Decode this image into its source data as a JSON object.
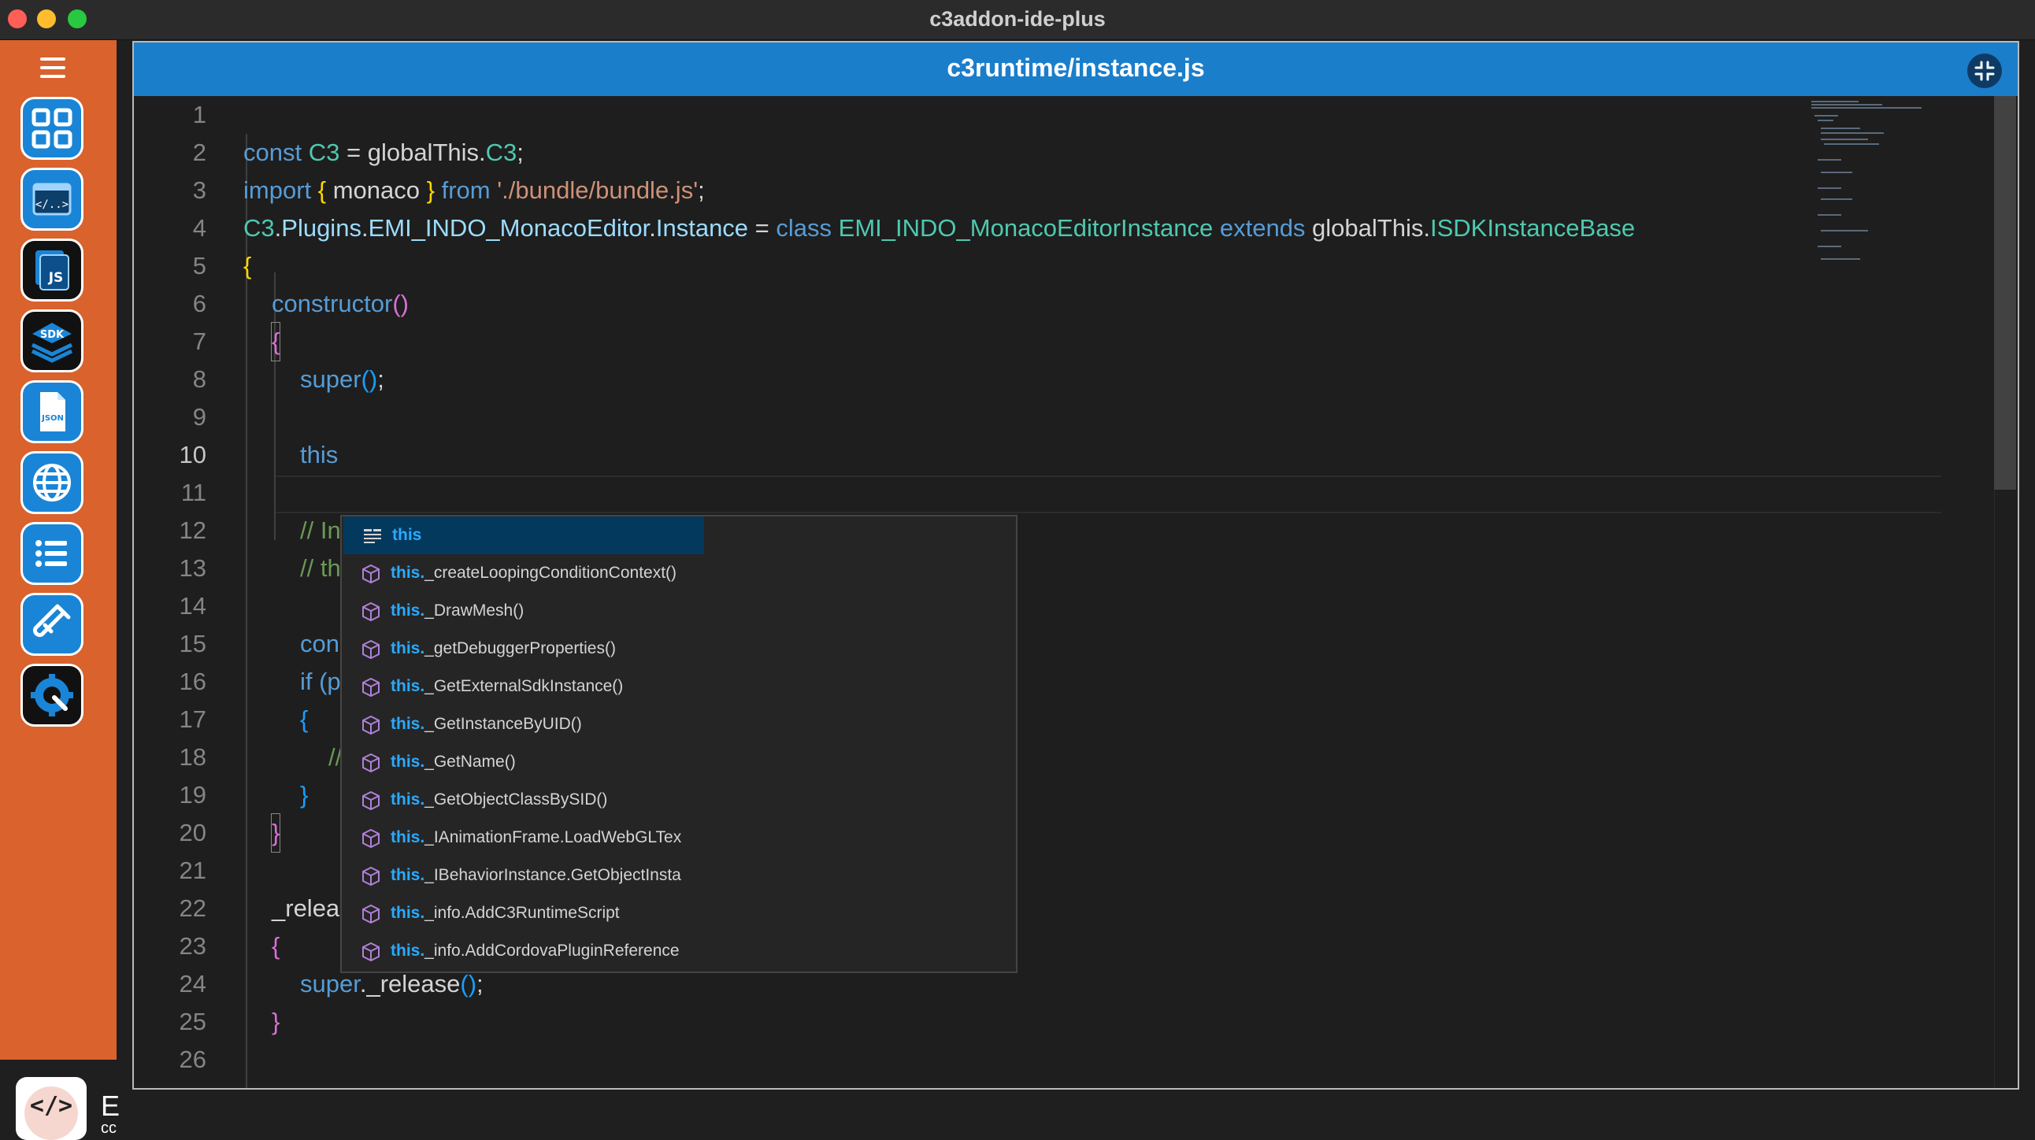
{
  "window": {
    "title": "c3addon-ide-plus"
  },
  "sidebar": {
    "buttons": [
      {
        "name": "dashboard",
        "icon": "grid-icon"
      },
      {
        "name": "code-editor",
        "icon": "code-window-icon"
      },
      {
        "name": "js-files",
        "icon": "js-files-icon"
      },
      {
        "name": "sdk",
        "icon": "sdk-layers-icon"
      },
      {
        "name": "json",
        "icon": "json-file-icon"
      },
      {
        "name": "language",
        "icon": "globe-icon"
      },
      {
        "name": "list",
        "icon": "list-icon"
      },
      {
        "name": "test",
        "icon": "test-tube-icon"
      },
      {
        "name": "settings",
        "icon": "wrench-gear-icon"
      }
    ]
  },
  "bottom_strip": {
    "logo_text": "E",
    "logo_sub": "cc"
  },
  "editor": {
    "file_title": "c3runtime/instance.js",
    "active_line": 10,
    "lines": [
      {
        "n": "1",
        "text": ""
      },
      {
        "n": "2",
        "text": "const C3 = globalThis.C3;"
      },
      {
        "n": "3",
        "text": "import { monaco } from './bundle/bundle.js';"
      },
      {
        "n": "4",
        "text": "C3.Plugins.EMI_INDO_MonacoEditor.Instance = class EMI_INDO_MonacoEditorInstance extends globalThis.ISDKInstanceBase"
      },
      {
        "n": "5",
        "text": "{"
      },
      {
        "n": "6",
        "text": "constructor()"
      },
      {
        "n": "7",
        "text": "{"
      },
      {
        "n": "8",
        "text": "super();"
      },
      {
        "n": "9",
        "text": ""
      },
      {
        "n": "10",
        "text": "this"
      },
      {
        "n": "11",
        "text": ""
      },
      {
        "n": "12",
        "text": "// In"
      },
      {
        "n": "13",
        "text": "// th"
      },
      {
        "n": "14",
        "text": ""
      },
      {
        "n": "15",
        "text": "con"
      },
      {
        "n": "16",
        "text": "if (p"
      },
      {
        "n": "17",
        "text": "{"
      },
      {
        "n": "18",
        "text": "//"
      },
      {
        "n": "19",
        "text": "}"
      },
      {
        "n": "20",
        "text": "}"
      },
      {
        "n": "21",
        "text": ""
      },
      {
        "n": "22",
        "text": "_relea"
      },
      {
        "n": "23",
        "text": "{"
      },
      {
        "n": "24",
        "text": "super._release();"
      },
      {
        "n": "25",
        "text": "}"
      },
      {
        "n": "26",
        "text": ""
      }
    ]
  },
  "suggestions": {
    "items": [
      {
        "prefix": "this",
        "rest": "",
        "icon": "snippet-icon",
        "selected": true
      },
      {
        "prefix": "this.",
        "rest": "_createLoopingConditionContext()",
        "icon": "method-cube-icon"
      },
      {
        "prefix": "this.",
        "rest": "_DrawMesh()",
        "icon": "method-cube-icon"
      },
      {
        "prefix": "this.",
        "rest": "_getDebuggerProperties()",
        "icon": "method-cube-icon"
      },
      {
        "prefix": "this.",
        "rest": "_GetExternalSdkInstance()",
        "icon": "method-cube-icon"
      },
      {
        "prefix": "this.",
        "rest": "_GetInstanceByUID()",
        "icon": "method-cube-icon"
      },
      {
        "prefix": "this.",
        "rest": "_GetName()",
        "icon": "method-cube-icon"
      },
      {
        "prefix": "this.",
        "rest": "_GetObjectClassBySID()",
        "icon": "method-cube-icon"
      },
      {
        "prefix": "this.",
        "rest": "_IAnimationFrame.LoadWebGLTex",
        "icon": "method-cube-icon"
      },
      {
        "prefix": "this.",
        "rest": "_IBehaviorInstance.GetObjectInsta",
        "icon": "method-cube-icon"
      },
      {
        "prefix": "this.",
        "rest": "_info.AddC3RuntimeScript",
        "icon": "method-cube-icon"
      },
      {
        "prefix": "this.",
        "rest": "_info.AddCordovaPluginReference",
        "icon": "method-cube-icon"
      }
    ]
  },
  "colors": {
    "sidebar": "#d9622d",
    "header": "#1a7ecb",
    "editor_bg": "#1e1e1e",
    "suggest_bg": "#252526"
  }
}
